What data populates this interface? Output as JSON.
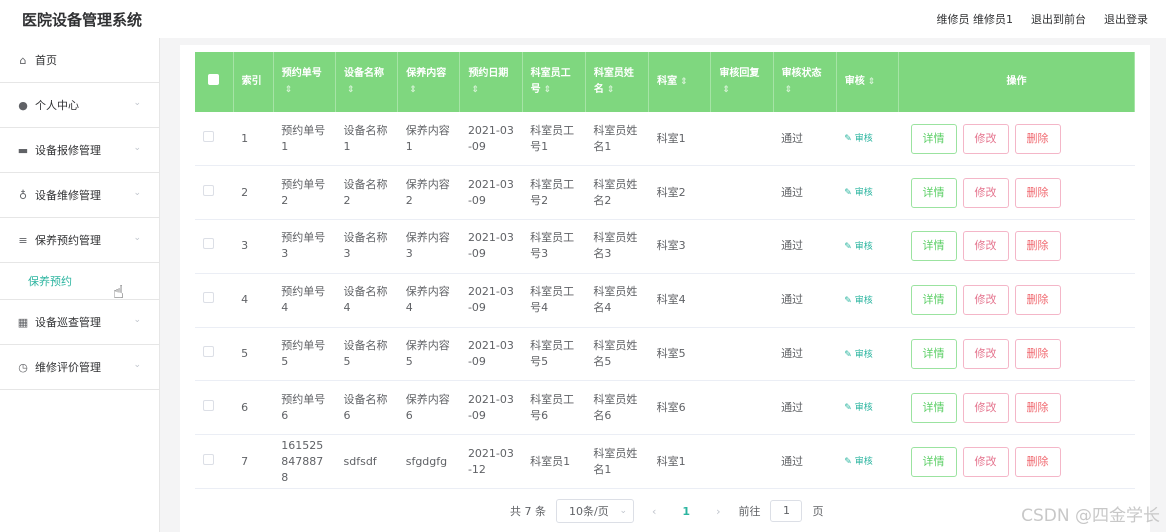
{
  "app_title": "医院设备管理系统",
  "top": {
    "user": "维修员 维修员1",
    "to_front": "退出到前台",
    "logout": "退出登录"
  },
  "sidebar": {
    "items": [
      {
        "label": "首页",
        "icon": "home-icon"
      },
      {
        "label": "个人中心",
        "icon": "user-icon"
      },
      {
        "label": "设备报修管理",
        "icon": "monitor-icon"
      },
      {
        "label": "设备维修管理",
        "icon": "mic-icon"
      },
      {
        "label": "保养预约管理",
        "icon": "menu-icon"
      },
      {
        "label": "设备巡查管理",
        "icon": "grid-icon"
      },
      {
        "label": "维修评价管理",
        "icon": "clock-icon"
      }
    ],
    "sub_item": "保养预约"
  },
  "table": {
    "headers": [
      "索引",
      "预约单号",
      "设备名称",
      "保养内容",
      "预约日期",
      "科室员工号",
      "科室员姓名",
      "科室",
      "审核回复",
      "审核状态",
      "审核",
      "操作"
    ],
    "rows": [
      [
        "1",
        "预约单号1",
        "设备名称1",
        "保养内容1",
        "2021-03-09",
        "科室员工号1",
        "科室员姓名1",
        "科室1",
        "",
        "通过"
      ],
      [
        "2",
        "预约单号2",
        "设备名称2",
        "保养内容2",
        "2021-03-09",
        "科室员工号2",
        "科室员姓名2",
        "科室2",
        "",
        "通过"
      ],
      [
        "3",
        "预约单号3",
        "设备名称3",
        "保养内容3",
        "2021-03-09",
        "科室员工号3",
        "科室员姓名3",
        "科室3",
        "",
        "通过"
      ],
      [
        "4",
        "预约单号4",
        "设备名称4",
        "保养内容4",
        "2021-03-09",
        "科室员工号4",
        "科室员姓名4",
        "科室4",
        "",
        "通过"
      ],
      [
        "5",
        "预约单号5",
        "设备名称5",
        "保养内容5",
        "2021-03-09",
        "科室员工号5",
        "科室员姓名5",
        "科室5",
        "",
        "通过"
      ],
      [
        "6",
        "预约单号6",
        "设备名称6",
        "保养内容6",
        "2021-03-09",
        "科室员工号6",
        "科室员姓名6",
        "科室6",
        "",
        "通过"
      ],
      [
        "7",
        "1615258478878",
        "sdfsdf",
        "sfgdgfg",
        "2021-03-12",
        "科室员1",
        "科室员姓名1",
        "科室1",
        "",
        "通过"
      ]
    ],
    "audit_label": "审核",
    "btn_detail": "详情",
    "btn_edit": "修改",
    "btn_delete": "删除"
  },
  "pager": {
    "total": "共 7 条",
    "page_size": "10条/页",
    "current": "1",
    "goto": "前往",
    "goto_value": "1",
    "page_unit": "页"
  },
  "watermark": "CSDN @四金学长",
  "colors": {
    "header_bg": "#7fd77f",
    "accent": "#2cb5a0"
  }
}
